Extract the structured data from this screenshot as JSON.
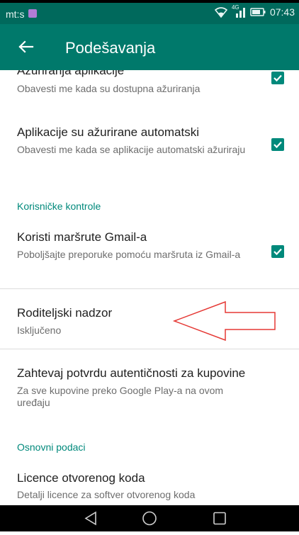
{
  "status_bar": {
    "carrier": "mt:s",
    "time": "07:43",
    "network_badge": "4G"
  },
  "app_bar": {
    "title": "Podešavanja"
  },
  "settings": {
    "app_updates": {
      "title": "Ažuriranja aplikacije",
      "subtitle": "Obavesti me kada su dostupna ažuriranja",
      "checked": true
    },
    "auto_updated": {
      "title": "Aplikacije su ažurirane automatski",
      "subtitle": "Obavesti me kada se aplikacije automatski ažuriraju",
      "checked": true
    },
    "user_controls_header": "Korisničke kontrole",
    "gmail_routes": {
      "title": "Koristi maršrute Gmail-a",
      "subtitle": "Poboljšajte preporuke pomoću maršruta iz Gmail-a",
      "checked": true
    },
    "parental_control": {
      "title": "Roditeljski nadzor",
      "subtitle": "Isključeno"
    },
    "purchase_auth": {
      "title": "Zahtevaj potvrdu autentičnosti za kupovine",
      "subtitle": "Za sve kupovine preko Google Play-a na ovom uređaju"
    },
    "basic_info_header": "Osnovni podaci",
    "open_source": {
      "title": "Licence otvorenog koda",
      "subtitle": "Detalji licence za softver otvorenog koda"
    }
  },
  "icons": {
    "back": "arrow-back-icon",
    "checkbox": "checkbox-checked-icon",
    "nav_back": "nav-back-icon",
    "nav_home": "nav-home-icon",
    "nav_recents": "nav-recents-icon"
  },
  "colors": {
    "status_bar": "#00695c",
    "app_bar": "#00796b",
    "accent": "#00897b",
    "annotation_arrow": "#e53935"
  }
}
